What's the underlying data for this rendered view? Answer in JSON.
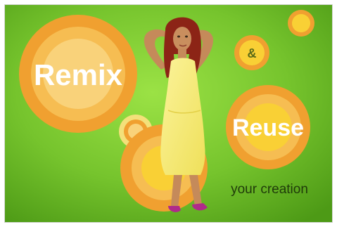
{
  "banner": {
    "remix_word": "Remix",
    "ampersand": "&",
    "reuse_word": "Reuse",
    "tagline": "your creation"
  },
  "colors": {
    "background_light": "#8ed83a",
    "background_dark": "#4d9a16",
    "circle_outer": "#f0a030",
    "circle_mid": "#f6bd52",
    "circle_inner": "#f9d97a",
    "dress": "#f7ef74",
    "hair": "#8c2416",
    "skin": "#c58a5a",
    "shoes": "#b02a8a",
    "text_white": "#ffffff",
    "text_tagline": "#1f3a0a"
  }
}
